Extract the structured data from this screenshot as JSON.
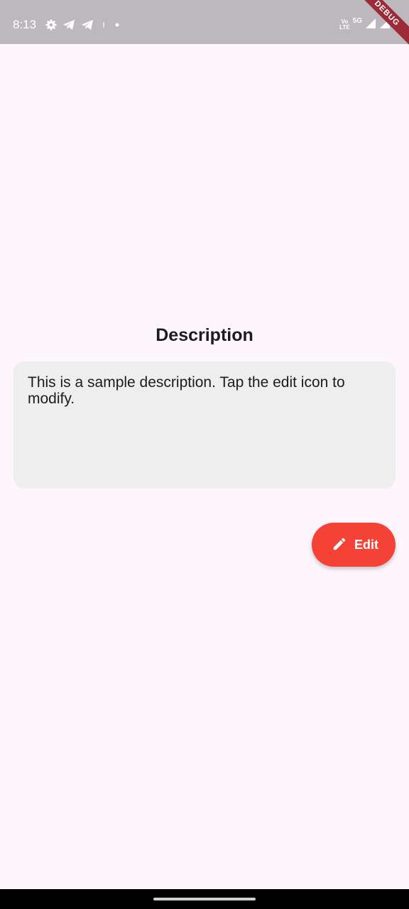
{
  "status_bar": {
    "time": "8:13",
    "left_icons": [
      "gear-icon",
      "telegram-icon",
      "telegram-icon",
      "notification-icon",
      "dot-icon"
    ],
    "volte_line1": "Vo",
    "volte_line2": "LTE",
    "network": "5G",
    "right_icons": [
      "signal-icon",
      "signal-icon",
      "battery-icon"
    ]
  },
  "debug_banner": "DEBUG",
  "main": {
    "title": "Description",
    "description": "This is a sample description. Tap the edit icon to modify.",
    "edit_button": {
      "label": "Edit",
      "icon": "pencil-icon"
    }
  },
  "colors": {
    "background": "#fdf7fd",
    "status_bar": "#bdb8bd",
    "card": "#eeeeee",
    "accent": "#f44336",
    "text": "#1d1b20"
  }
}
